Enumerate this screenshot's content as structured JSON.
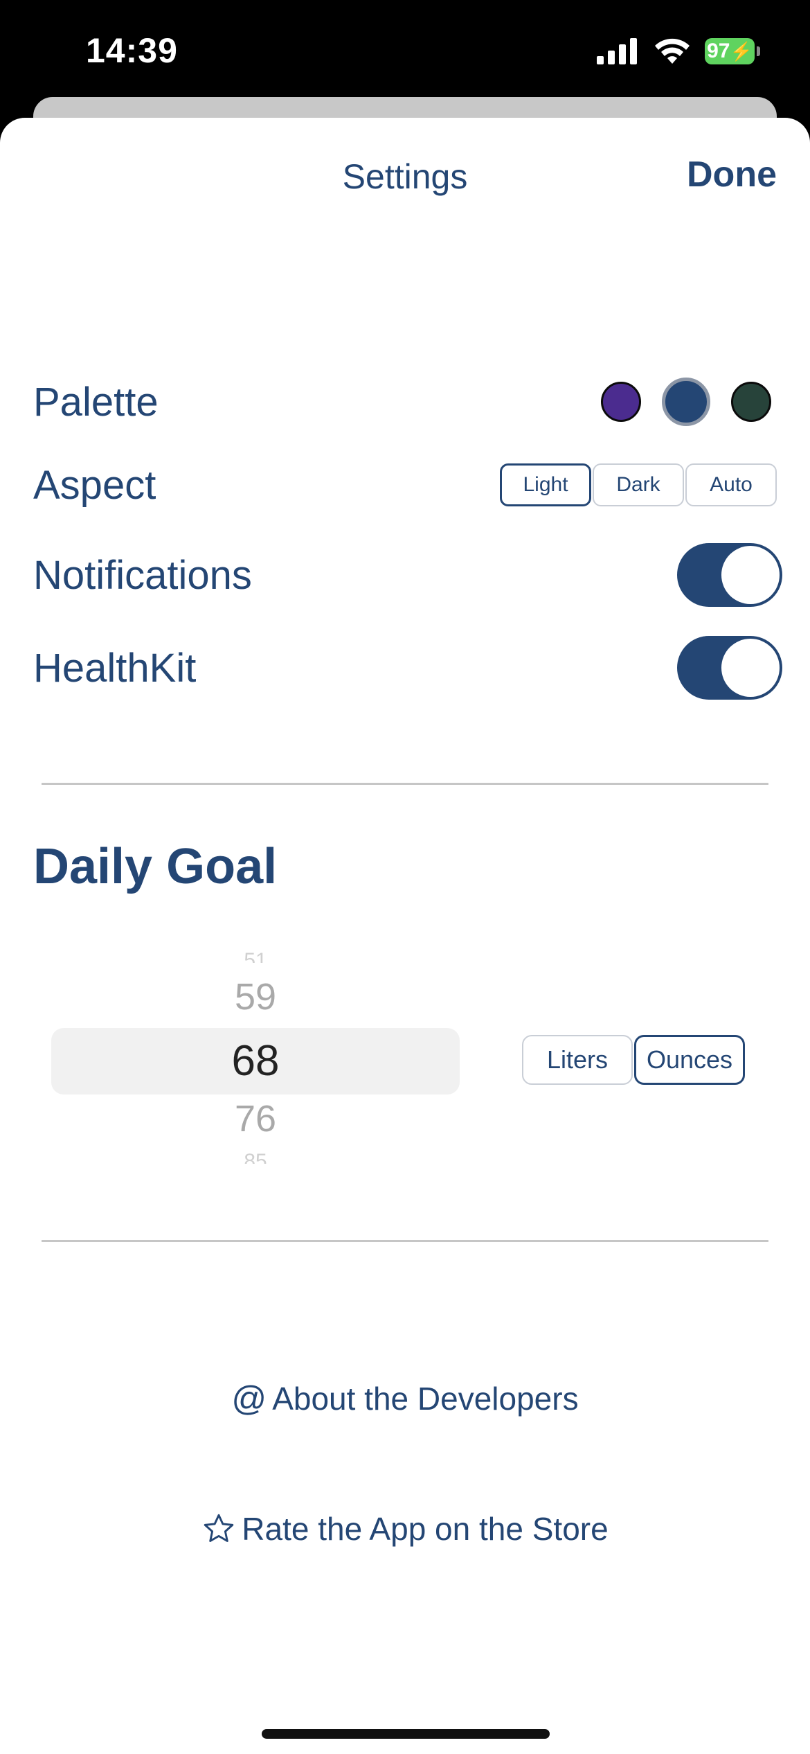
{
  "status_bar": {
    "time": "14:39",
    "battery": "97"
  },
  "header": {
    "title": "Settings",
    "done_label": "Done"
  },
  "settings": {
    "palette": {
      "label": "Palette",
      "swatches": [
        "#4b2c8f",
        "#244674",
        "#27433a"
      ],
      "selected_index": 1
    },
    "aspect": {
      "label": "Aspect",
      "options": [
        "Light",
        "Dark",
        "Auto"
      ],
      "selected": "Light"
    },
    "notifications": {
      "label": "Notifications",
      "enabled": true
    },
    "healthkit": {
      "label": "HealthKit",
      "enabled": true
    }
  },
  "daily_goal": {
    "title": "Daily Goal",
    "picker_values": [
      "51",
      "59",
      "68",
      "76",
      "85"
    ],
    "selected_value": "68",
    "units": [
      "Liters",
      "Ounces"
    ],
    "selected_unit": "Ounces"
  },
  "links": {
    "about": {
      "icon": "at-icon",
      "label": "About the Developers"
    },
    "rate": {
      "icon": "star-icon",
      "label": "Rate the App on the Store"
    }
  },
  "colors": {
    "accent": "#244674",
    "toggle_on": "#244674"
  }
}
